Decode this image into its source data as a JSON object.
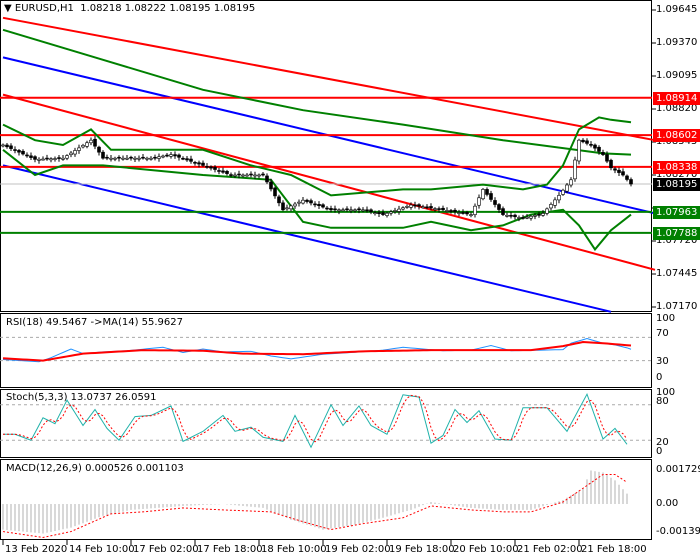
{
  "header": {
    "symbol": "EURUSD,H1",
    "ohlc": "1.08218 1.08222 1.08195 1.08195"
  },
  "price_axis": [
    "1.09645",
    "1.09370",
    "1.09095",
    "1.08820",
    "1.08545",
    "1.08270",
    "1.07720",
    "1.07445",
    "1.07170"
  ],
  "levels": [
    {
      "label": "1.08914",
      "value": 1.08914,
      "color": "#ff0000"
    },
    {
      "label": "1.08602",
      "value": 1.08602,
      "color": "#ff0000"
    },
    {
      "label": "1.08338",
      "value": 1.08338,
      "color": "#ff0000"
    },
    {
      "label": "1.07963",
      "value": 1.07963,
      "color": "#008000"
    },
    {
      "label": "1.07788",
      "value": 1.07788,
      "color": "#008000"
    }
  ],
  "current_price": {
    "label": "1.08195",
    "value": 1.08195,
    "color": "#000000"
  },
  "rsi": {
    "title": "RSI(18) 49.5467  ->MA(14) 55.9627",
    "axis": [
      "100",
      "70",
      "30",
      "0"
    ]
  },
  "stoch": {
    "title": "Stoch(5,3,3) 13.0737 26.0591",
    "axis": [
      "100",
      "80",
      "20",
      "0"
    ]
  },
  "macd": {
    "title": "MACD(12,26,9) 0.000526 0.001103",
    "axis": [
      "0.001729",
      "0.00",
      "-0.001399"
    ]
  },
  "time_axis": [
    "13 Feb 2020",
    "14 Feb 10:00",
    "17 Feb 02:00",
    "17 Feb 18:00",
    "18 Feb 10:00",
    "19 Feb 02:00",
    "19 Feb 18:00",
    "20 Feb 10:00",
    "21 Feb 02:00",
    "21 Feb 18:00"
  ],
  "chart_data": {
    "type": "line",
    "title": "EURUSD,H1",
    "x_unit": "bar index (hourly)",
    "ylim": [
      1.0714,
      1.097
    ],
    "close": [
      [
        0,
        1.0852
      ],
      [
        8,
        1.084
      ],
      [
        15,
        1.0841
      ],
      [
        22,
        1.0856
      ],
      [
        25,
        1.0841
      ],
      [
        37,
        1.0841
      ],
      [
        42,
        1.0844
      ],
      [
        50,
        1.0835
      ],
      [
        57,
        1.0827
      ],
      [
        65,
        1.0827
      ],
      [
        70,
        1.0798
      ],
      [
        75,
        1.0806
      ],
      [
        82,
        1.0798
      ],
      [
        90,
        1.0798
      ],
      [
        95,
        1.0794
      ],
      [
        102,
        1.0802
      ],
      [
        110,
        1.0798
      ],
      [
        117,
        1.0794
      ],
      [
        120,
        1.0815
      ],
      [
        125,
        1.0794
      ],
      [
        130,
        1.0791
      ],
      [
        135,
        1.0795
      ],
      [
        139,
        1.081
      ],
      [
        142,
        1.0823
      ],
      [
        144,
        1.0856
      ],
      [
        147,
        1.0852
      ],
      [
        150,
        1.0844
      ],
      [
        152,
        1.0833
      ],
      [
        155,
        1.0827
      ],
      [
        157,
        1.08195
      ]
    ],
    "ma_long": [
      [
        0,
        1.0948
      ],
      [
        25,
        1.0923
      ],
      [
        50,
        1.0898
      ],
      [
        75,
        1.0881
      ],
      [
        100,
        1.0869
      ],
      [
        125,
        1.0856
      ],
      [
        150,
        1.0845
      ],
      [
        157,
        1.0844
      ]
    ],
    "bb_upper": [
      [
        0,
        1.0869
      ],
      [
        8,
        1.0856
      ],
      [
        15,
        1.0852
      ],
      [
        22,
        1.0865
      ],
      [
        27,
        1.0848
      ],
      [
        50,
        1.0848
      ],
      [
        62,
        1.0835
      ],
      [
        67,
        1.0831
      ],
      [
        72,
        1.0827
      ],
      [
        82,
        1.081
      ],
      [
        100,
        1.0815
      ],
      [
        107,
        1.0815
      ],
      [
        120,
        1.0819
      ],
      [
        130,
        1.0815
      ],
      [
        136,
        1.0819
      ],
      [
        140,
        1.0835
      ],
      [
        144,
        1.0865
      ],
      [
        149,
        1.0875
      ],
      [
        152,
        1.0873
      ],
      [
        157,
        1.0871
      ]
    ],
    "bb_lower": [
      [
        0,
        1.0848
      ],
      [
        8,
        1.0827
      ],
      [
        15,
        1.0835
      ],
      [
        25,
        1.0835
      ],
      [
        50,
        1.0827
      ],
      [
        67,
        1.0823
      ],
      [
        75,
        1.0788
      ],
      [
        82,
        1.0783
      ],
      [
        100,
        1.0783
      ],
      [
        107,
        1.0788
      ],
      [
        117,
        1.0781
      ],
      [
        125,
        1.0785
      ],
      [
        132,
        1.0794
      ],
      [
        140,
        1.0798
      ],
      [
        144,
        1.0785
      ],
      [
        148,
        1.0765
      ],
      [
        152,
        1.0781
      ],
      [
        157,
        1.0794
      ]
    ],
    "trendlines": [
      {
        "color": "#ff0000",
        "from": [
          0,
          1.0958
        ],
        "to": [
          163,
          1.0856
        ]
      },
      {
        "color": "#ff0000",
        "from": [
          0,
          1.0894
        ],
        "to": [
          163,
          1.0748
        ]
      },
      {
        "color": "#0000ff",
        "from": [
          0,
          1.0925
        ],
        "to": [
          163,
          1.0795
        ]
      },
      {
        "color": "#0000ff",
        "from": [
          0,
          1.0835
        ],
        "to": [
          152,
          1.0713
        ]
      }
    ],
    "rsi": [
      [
        0,
        32
      ],
      [
        9,
        28
      ],
      [
        12,
        35
      ],
      [
        17,
        50
      ],
      [
        20,
        42
      ],
      [
        25,
        45
      ],
      [
        31,
        47
      ],
      [
        40,
        53
      ],
      [
        45,
        44
      ],
      [
        50,
        50
      ],
      [
        55,
        45
      ],
      [
        62,
        46
      ],
      [
        67,
        38
      ],
      [
        72,
        33
      ],
      [
        80,
        41
      ],
      [
        87,
        44
      ],
      [
        95,
        48
      ],
      [
        100,
        53
      ],
      [
        110,
        47
      ],
      [
        117,
        48
      ],
      [
        122,
        56
      ],
      [
        127,
        47
      ],
      [
        135,
        48
      ],
      [
        140,
        49
      ],
      [
        142,
        60
      ],
      [
        146,
        68
      ],
      [
        150,
        60
      ],
      [
        153,
        57
      ],
      [
        156,
        52
      ],
      [
        157,
        49.55
      ]
    ],
    "rsi_ma": [
      [
        0,
        34
      ],
      [
        10,
        30
      ],
      [
        20,
        42
      ],
      [
        35,
        48
      ],
      [
        50,
        47
      ],
      [
        60,
        42
      ],
      [
        75,
        41
      ],
      [
        90,
        46
      ],
      [
        107,
        48
      ],
      [
        120,
        48
      ],
      [
        132,
        48
      ],
      [
        140,
        55
      ],
      [
        145,
        62
      ],
      [
        150,
        60
      ],
      [
        157,
        55.96
      ]
    ],
    "stoch_k": [
      [
        0,
        30
      ],
      [
        3,
        30
      ],
      [
        7,
        20
      ],
      [
        10,
        58
      ],
      [
        13,
        48
      ],
      [
        16,
        88
      ],
      [
        20,
        45
      ],
      [
        23,
        72
      ],
      [
        26,
        40
      ],
      [
        29,
        20
      ],
      [
        33,
        60
      ],
      [
        37,
        62
      ],
      [
        42,
        78
      ],
      [
        45,
        18
      ],
      [
        50,
        35
      ],
      [
        55,
        62
      ],
      [
        58,
        35
      ],
      [
        62,
        42
      ],
      [
        65,
        25
      ],
      [
        70,
        18
      ],
      [
        73,
        62
      ],
      [
        77,
        8
      ],
      [
        82,
        80
      ],
      [
        85,
        45
      ],
      [
        89,
        78
      ],
      [
        92,
        45
      ],
      [
        96,
        30
      ],
      [
        100,
        97
      ],
      [
        104,
        93
      ],
      [
        107,
        15
      ],
      [
        110,
        28
      ],
      [
        113,
        72
      ],
      [
        116,
        50
      ],
      [
        119,
        70
      ],
      [
        123,
        22
      ],
      [
        127,
        20
      ],
      [
        130,
        75
      ],
      [
        136,
        75
      ],
      [
        141,
        35
      ],
      [
        146,
        98
      ],
      [
        150,
        22
      ],
      [
        153,
        40
      ],
      [
        156,
        13.07
      ]
    ],
    "macd_hist": [
      [
        0,
        -0.0013
      ],
      [
        10,
        -0.0015
      ],
      [
        17,
        -0.0012
      ],
      [
        25,
        -0.0006
      ],
      [
        32,
        -0.0003
      ],
      [
        45,
        -0.0001
      ],
      [
        55,
        0
      ],
      [
        65,
        -0.0002
      ],
      [
        72,
        -0.0008
      ],
      [
        80,
        -0.0013
      ],
      [
        87,
        -0.0011
      ],
      [
        95,
        -0.0007
      ],
      [
        102,
        -0.0003
      ],
      [
        107,
        0.0001
      ],
      [
        117,
        -0.0002
      ],
      [
        125,
        -0.0003
      ],
      [
        132,
        -0.0003
      ],
      [
        140,
        0.0002
      ],
      [
        145,
        0.0008
      ],
      [
        147,
        0.0017
      ],
      [
        150,
        0.0016
      ],
      [
        153,
        0.0012
      ],
      [
        156,
        0.000526
      ]
    ],
    "macd_signal": [
      [
        0,
        -0.0014
      ],
      [
        10,
        -0.0017
      ],
      [
        17,
        -0.0014
      ],
      [
        27,
        -0.0005
      ],
      [
        35,
        -0.0004
      ],
      [
        45,
        -0.0002
      ],
      [
        55,
        -0.0003
      ],
      [
        67,
        -0.0004
      ],
      [
        75,
        -0.0009
      ],
      [
        82,
        -0.0013
      ],
      [
        90,
        -0.001
      ],
      [
        100,
        -0.0007
      ],
      [
        107,
        -0.0001
      ],
      [
        117,
        -0.0003
      ],
      [
        125,
        -0.0004
      ],
      [
        132,
        -0.0004
      ],
      [
        140,
        0.0001
      ],
      [
        145,
        0.0008
      ],
      [
        150,
        0.0015
      ],
      [
        153,
        0.0015
      ],
      [
        156,
        0.001103
      ]
    ]
  }
}
